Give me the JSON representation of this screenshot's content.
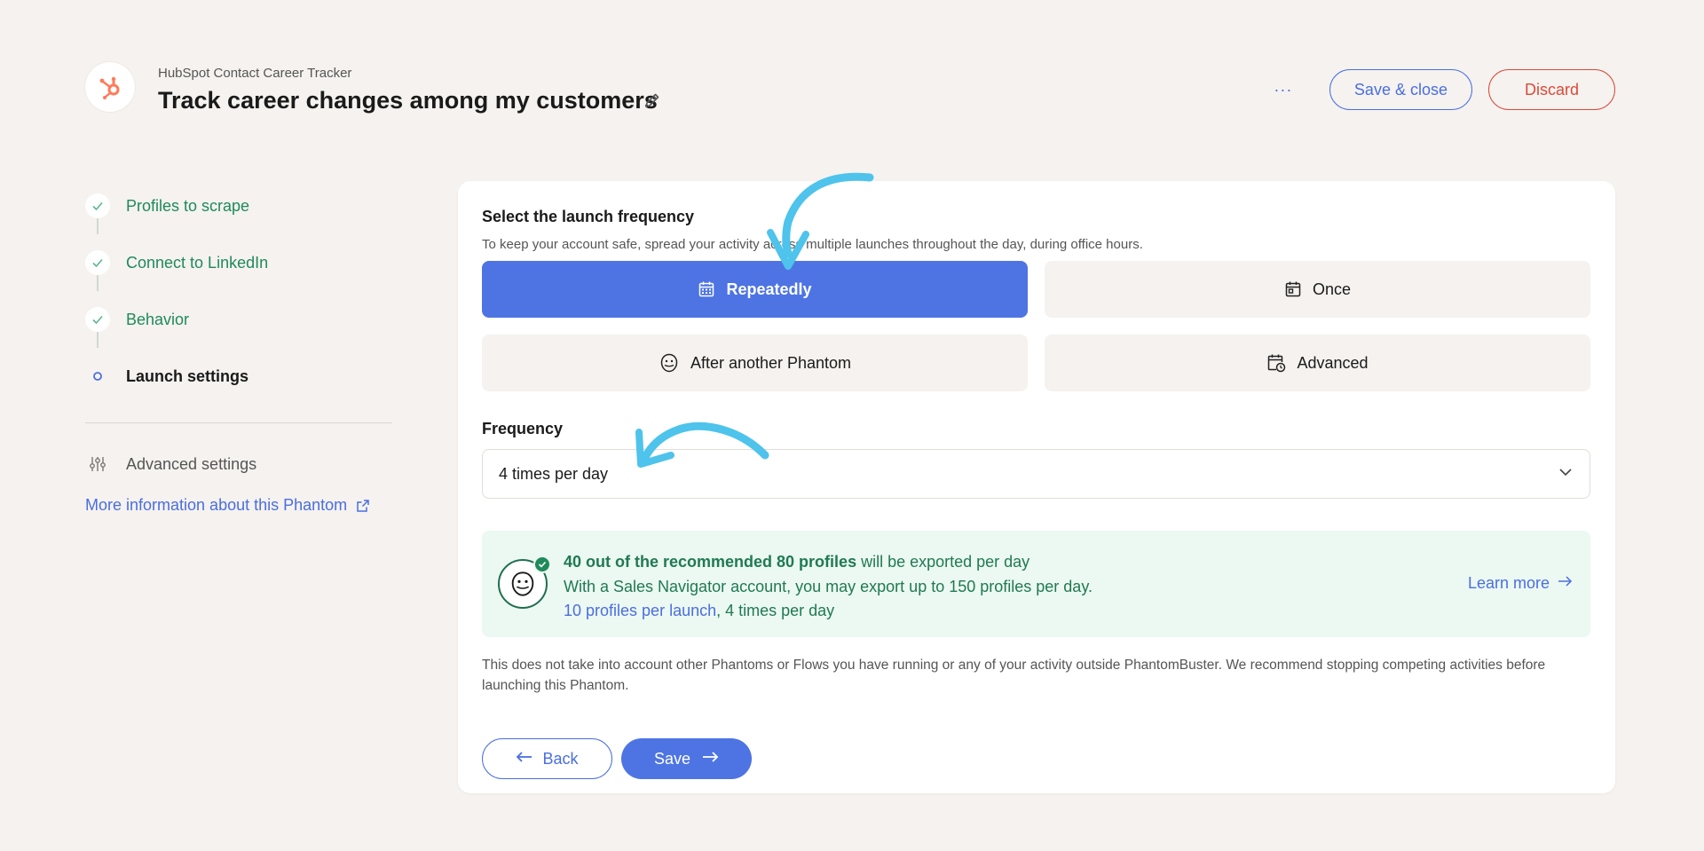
{
  "header": {
    "subtitle": "HubSpot Contact Career Tracker",
    "title": "Track career changes among my customers",
    "more_label": "···",
    "save_close_label": "Save & close",
    "discard_label": "Discard"
  },
  "sidebar": {
    "steps": [
      {
        "label": "Profiles to scrape",
        "status": "done"
      },
      {
        "label": "Connect to LinkedIn",
        "status": "done"
      },
      {
        "label": "Behavior",
        "status": "done"
      },
      {
        "label": "Launch settings",
        "status": "active"
      }
    ],
    "advanced_settings_label": "Advanced settings",
    "more_info_label": "More information about this Phantom"
  },
  "launch": {
    "title": "Select the launch frequency",
    "description": "To keep your account safe, spread your activity across multiple launches throughout the day, during office hours.",
    "options": [
      {
        "label": "Repeatedly",
        "icon": "calendar-icon",
        "selected": true
      },
      {
        "label": "Once",
        "icon": "calendar-day-icon",
        "selected": false
      },
      {
        "label": "After another Phantom",
        "icon": "phantom-icon",
        "selected": false
      },
      {
        "label": "Advanced",
        "icon": "calendar-clock-icon",
        "selected": false
      }
    ]
  },
  "frequency": {
    "label": "Frequency",
    "value": "4 times per day"
  },
  "info": {
    "line1_bold": "40 out of the recommended 80 profiles",
    "line1_rest": " will be exported per day",
    "line2": "With a Sales Navigator account, you may export up to 150 profiles per day.",
    "line3_link": "10 profiles per launch",
    "line3_rest": ", 4 times per day",
    "learn_more": "Learn more"
  },
  "disclaimer": "This does not take into account other Phantoms or Flows you have running or any of your activity outside PhantomBuster. We recommend stopping competing activities before launching this Phantom.",
  "footer": {
    "back_label": "Back",
    "save_label": "Save"
  },
  "colors": {
    "primary": "#4e74e3",
    "success": "#1f8a5a",
    "danger": "#d94a3a",
    "background": "#f5f2ef",
    "hubspot": "#ff7a59",
    "annotation": "#4ec3ec"
  }
}
